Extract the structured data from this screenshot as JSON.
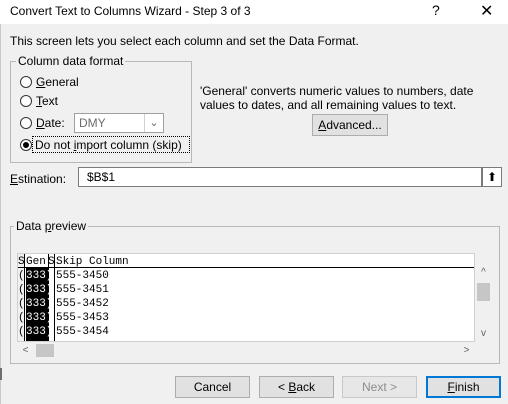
{
  "window": {
    "title": "Convert Text to Columns Wizard - Step 3 of 3",
    "help_glyph": "?",
    "close_glyph": "✕"
  },
  "intro_text": "This screen lets you select each column and set the Data Format.",
  "column_format": {
    "legend": "Column data format",
    "options": [
      {
        "pre": "",
        "key": "G",
        "post": "eneral",
        "checked": false
      },
      {
        "pre": "",
        "key": "T",
        "post": "ext",
        "checked": false
      },
      {
        "pre": "",
        "key": "D",
        "post": "ate:",
        "checked": false
      },
      {
        "pre": "Do not ",
        "key": "i",
        "post": "mport column (skip)",
        "checked": true
      }
    ],
    "date_select": {
      "value": "DMY",
      "arrow": "⌄"
    }
  },
  "description": "'General' converts numeric values to numbers, date values to dates, and all remaining values to text.",
  "advanced_button": {
    "pre": "",
    "key": "A",
    "post": "dvanced..."
  },
  "destination": {
    "label_pre": "",
    "label_key": "E",
    "label_post": "stination:",
    "value": "$B$1",
    "collapse_icon": "⬆"
  },
  "preview": {
    "legend_pre": "Data ",
    "legend_key": "p",
    "legend_post": "review",
    "headers": [
      "S",
      "Gen",
      "S",
      "Skip Column"
    ],
    "rows": [
      [
        "(",
        "333)",
        "555-3450"
      ],
      [
        "(",
        "333)",
        "555-3451"
      ],
      [
        "(",
        "333)",
        "555-3452"
      ],
      [
        "(",
        "333)",
        "555-3453"
      ],
      [
        "(",
        "333)",
        "555-3454"
      ]
    ],
    "scroll_up": "^",
    "scroll_down": "v",
    "scroll_left": "<",
    "scroll_right": ">"
  },
  "buttons": {
    "cancel": {
      "pre": "Cancel",
      "key": "",
      "post": ""
    },
    "back": {
      "pre": "< ",
      "key": "B",
      "post": "ack"
    },
    "next": {
      "pre": "Next >",
      "key": "",
      "post": ""
    },
    "finish": {
      "pre": "",
      "key": "F",
      "post": "inish"
    }
  }
}
